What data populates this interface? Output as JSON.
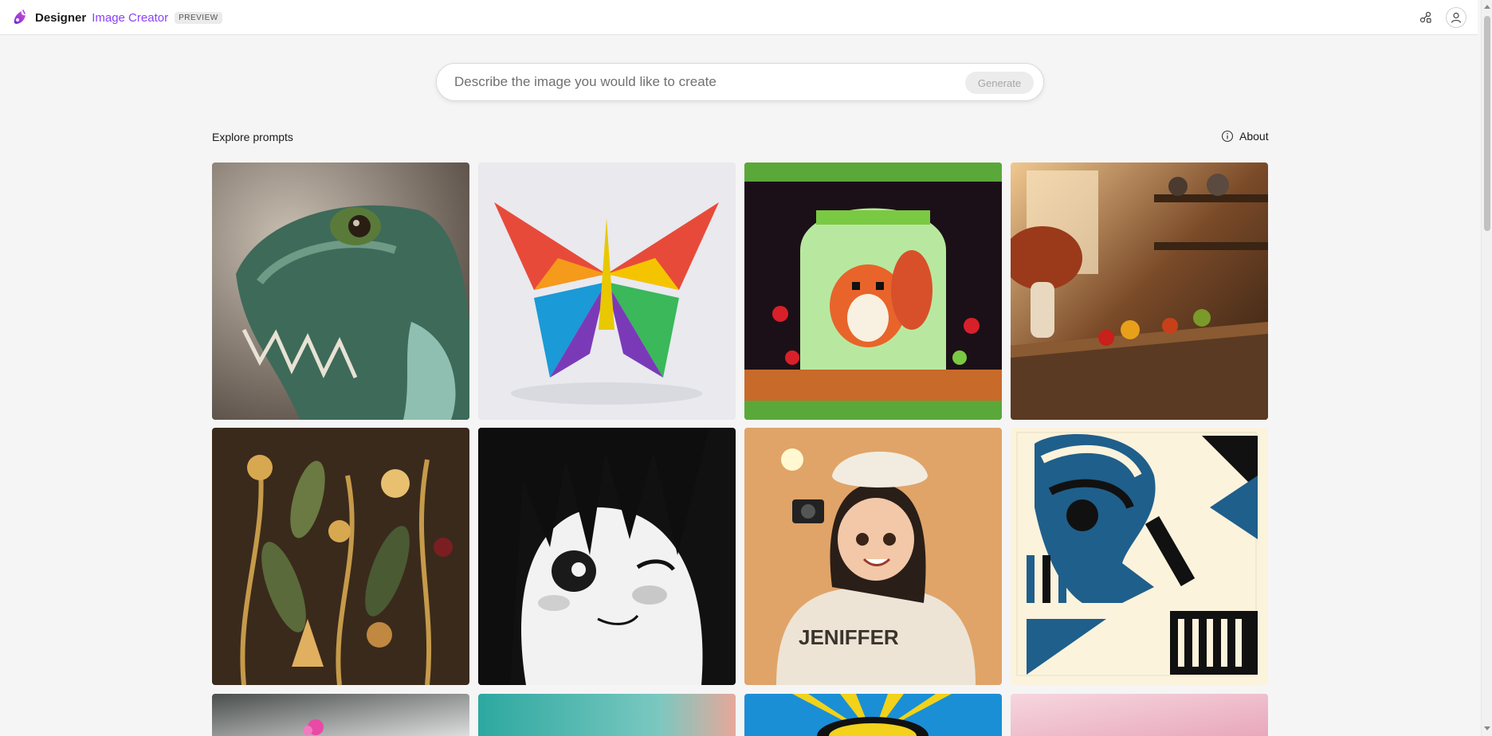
{
  "header": {
    "app_name": "Designer",
    "product_name": "Image Creator",
    "badge": "PREVIEW",
    "icons": [
      "designer-logo-icon",
      "share-icon",
      "account-icon"
    ]
  },
  "prompt": {
    "placeholder": "Describe the image you would like to create",
    "value": "",
    "generate_label": "Generate"
  },
  "explore": {
    "title": "Explore prompts",
    "about_label": "About"
  },
  "gallery": {
    "rows_visible": 3,
    "columns": 4,
    "tiles": [
      {
        "subject": "iguana",
        "colors": [
          "#3d5a4a",
          "#8fa79a"
        ]
      },
      {
        "subject": "rainbow-origami-butterfly",
        "colors": [
          "#e8e8ec",
          "#f5c400"
        ]
      },
      {
        "subject": "pixel-squirrel",
        "colors": [
          "#1a1020",
          "#7ac943"
        ]
      },
      {
        "subject": "rustic-kitchen",
        "colors": [
          "#4a2c18",
          "#d9904a"
        ]
      },
      {
        "subject": "botanical-pattern",
        "colors": [
          "#3a2a1c",
          "#c59a4a"
        ]
      },
      {
        "subject": "manga-girl",
        "colors": [
          "#111111",
          "#f2f2f2"
        ]
      },
      {
        "subject": "3d-girl-camera",
        "colors": [
          "#e0a468",
          "#ede4d6"
        ]
      },
      {
        "subject": "scientist-poster",
        "colors": [
          "#fbf3dc",
          "#1f5f8b"
        ]
      },
      {
        "subject": "flower-partial",
        "colors": [
          "#4a4e4c",
          "#e84aa6"
        ]
      },
      {
        "subject": "teal-partial",
        "colors": [
          "#2ca8a0",
          "#e6a89a"
        ]
      },
      {
        "subject": "sunburst-partial",
        "colors": [
          "#1a8fd6",
          "#f2d21a"
        ]
      },
      {
        "subject": "pink-partial",
        "colors": [
          "#f2c6d2",
          "#e8a8bc"
        ]
      }
    ]
  }
}
